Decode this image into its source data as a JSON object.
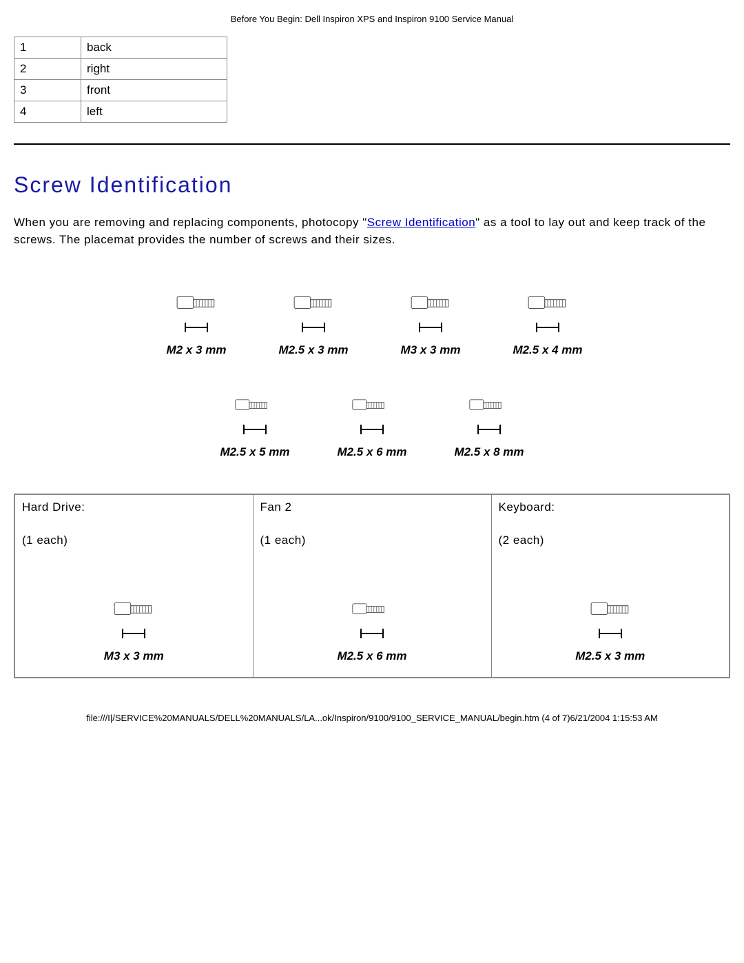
{
  "doc_header": "Before You Begin: Dell Inspiron XPS and Inspiron 9100 Service Manual",
  "dir_table": [
    {
      "num": "1",
      "label": "back"
    },
    {
      "num": "2",
      "label": "right"
    },
    {
      "num": "3",
      "label": "front"
    },
    {
      "num": "4",
      "label": "left"
    }
  ],
  "section_title": "Screw Identification",
  "body_text_pre": "When you are removing and replacing components, photocopy \"",
  "body_link": "Screw Identification",
  "body_text_post": "\" as a tool to lay out and keep track of the screws. The placemat provides the number of screws and their sizes.",
  "screw_rows": [
    [
      "M2 x 3 mm",
      "M2.5 x 3 mm",
      "M3 x 3 mm",
      "M2.5 x 4 mm"
    ],
    [
      "M2.5 x 5 mm",
      "M2.5 x 6 mm",
      "M2.5 x 8 mm"
    ]
  ],
  "components": [
    {
      "title": "Hard Drive:",
      "qty": "(1 each)",
      "screw": "M3 x 3 mm"
    },
    {
      "title": "Fan 2",
      "qty": "(1 each)",
      "screw": "M2.5 x 6 mm"
    },
    {
      "title": "Keyboard:",
      "qty": "(2 each)",
      "screw": "M2.5 x 3 mm"
    }
  ],
  "footer": "file:///I|/SERVICE%20MANUALS/DELL%20MANUALS/LA...ok/Inspiron/9100/9100_SERVICE_MANUAL/begin.htm (4 of 7)6/21/2004 1:15:53 AM"
}
